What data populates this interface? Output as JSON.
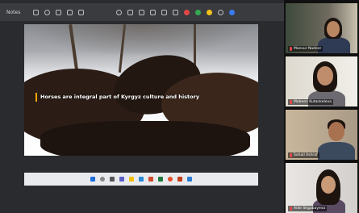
{
  "toolbar": {
    "title": "Notes"
  },
  "slide": {
    "caption": "Horses are integral part of Kyrgyz culture and history"
  },
  "participants": [
    {
      "name": "Mansur Nadeer"
    },
    {
      "name": "Mobeen Kutankeleva"
    },
    {
      "name": "Sohail Ashraf"
    },
    {
      "name": "Aide Shgabayeva"
    }
  ],
  "colors": {
    "accent": "#f0a400",
    "mic_muted": "#e04848"
  }
}
